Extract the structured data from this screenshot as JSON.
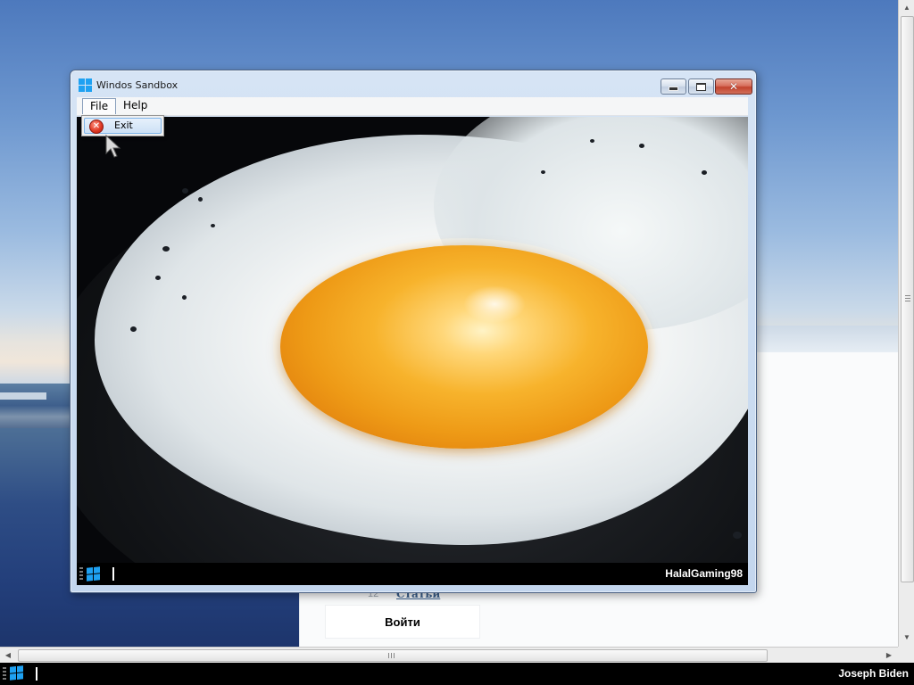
{
  "desktop": {
    "link_number": "12",
    "link_text": "Статьи",
    "login_button": "Войти"
  },
  "window": {
    "title": "Windos Sandbox",
    "menu": {
      "file": "File",
      "help": "Help",
      "file_items": [
        {
          "label": "Exit",
          "icon": "exit-icon"
        }
      ]
    },
    "controls": {
      "minimize_icon": "minimize-icon",
      "maximize_icon": "maximize-icon",
      "close_icon": "close-icon",
      "close_glyph": "✕"
    },
    "guest_screen": {
      "taskbar_user": "HalalGaming98"
    }
  },
  "taskbar": {
    "user": "Joseph Biden"
  },
  "scrollbars": {
    "up": "▲",
    "down": "▼",
    "left": "◀",
    "right": "▶"
  },
  "colors": {
    "start_logo": "#1ea1f2",
    "taskbar": "#000000",
    "close_button": "#c2432e"
  }
}
